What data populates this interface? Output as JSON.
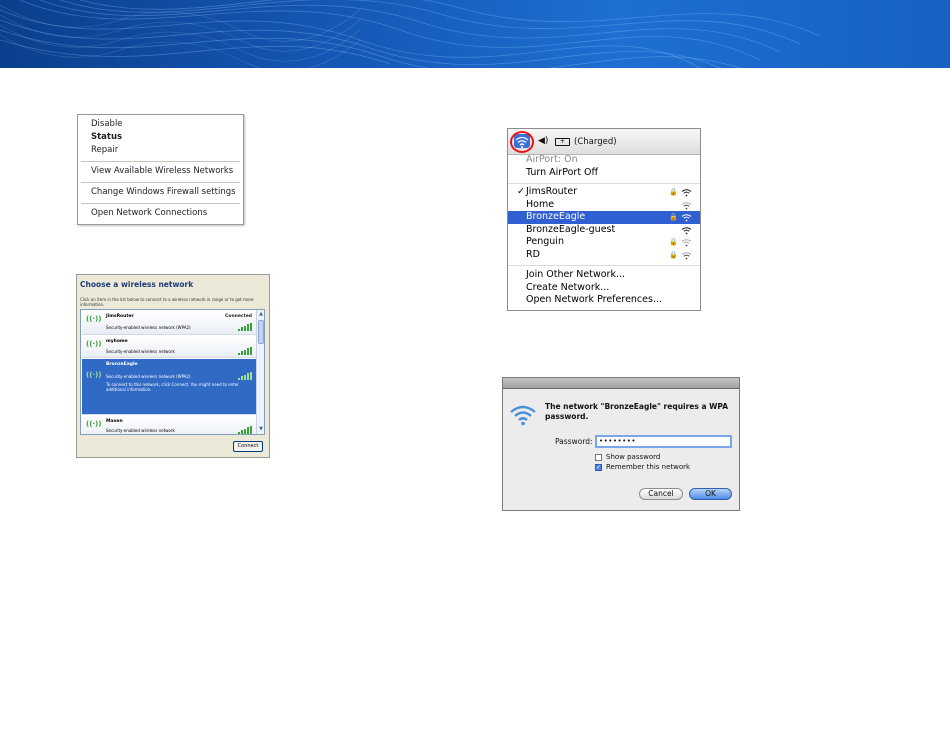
{
  "colors": {
    "banner": "#1457b5",
    "mac_selection": "#2f5fd0",
    "xp_selection": "#316ac5",
    "highlight_ring": "#e11111"
  },
  "win_context_menu": {
    "items": [
      "Disable",
      "Status",
      "Repair",
      "View Available Wireless Networks",
      "Change Windows Firewall settings",
      "Open Network Connections"
    ]
  },
  "win_network_list": {
    "title": "Choose a wireless network",
    "description": "Click an item in the list below to connect to a wireless network in range or to get more information.",
    "networks": [
      {
        "name": "JimsRouter",
        "security": "Security-enabled wireless network (WPA2)",
        "status": "Connected",
        "extra": ""
      },
      {
        "name": "myhome",
        "security": "Security-enabled wireless network",
        "status": "",
        "extra": ""
      },
      {
        "name": "BronzeEagle",
        "security": "Security-enabled wireless network (WPA2)",
        "status": "",
        "extra": "To connect to this network, click Connect. You might need to enter additional information."
      },
      {
        "name": "Maxen",
        "security": "Security-enabled wireless network",
        "status": "",
        "extra": ""
      }
    ],
    "connect_label": "Connect"
  },
  "mac_airport_menu": {
    "battery_status": "(Charged)",
    "airport_status": "AirPort: On",
    "toggle": "Turn AirPort Off",
    "networks": [
      {
        "name": "JimsRouter",
        "checked": true,
        "locked": true
      },
      {
        "name": "Home",
        "checked": false,
        "locked": false
      },
      {
        "name": "BronzeEagle",
        "checked": false,
        "locked": true,
        "selected": true
      },
      {
        "name": "BronzeEagle-guest",
        "checked": false,
        "locked": false
      },
      {
        "name": "Penguin",
        "checked": false,
        "locked": true
      },
      {
        "name": "RD",
        "checked": false,
        "locked": true
      }
    ],
    "actions": [
      "Join Other Network...",
      "Create Network...",
      "Open Network Preferences..."
    ]
  },
  "mac_wpa_dialog": {
    "message": "The network \"BronzeEagle\" requires a WPA password.",
    "password_label": "Password:",
    "password_value": "••••••••",
    "show_password": "Show password",
    "remember": "Remember this network",
    "cancel": "Cancel",
    "ok": "OK"
  }
}
